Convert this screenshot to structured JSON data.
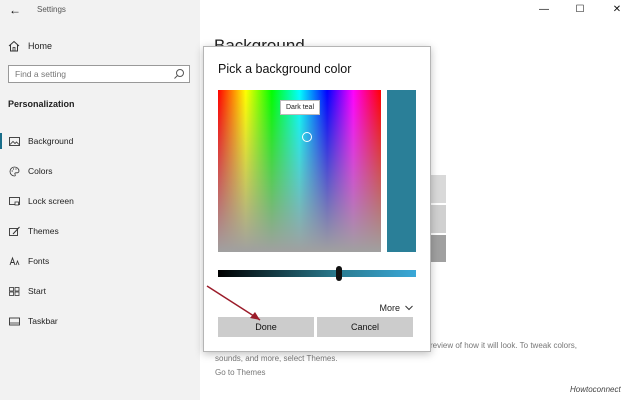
{
  "window": {
    "title": "Settings",
    "back": "←",
    "min": "—",
    "max": "☐",
    "close": "✕"
  },
  "sidebar": {
    "home_label": "Home",
    "search_placeholder": "Find a setting",
    "section_heading": "Personalization",
    "items": [
      {
        "label": "Background",
        "icon": "image-icon"
      },
      {
        "label": "Colors",
        "icon": "palette-icon"
      },
      {
        "label": "Lock screen",
        "icon": "lock-screen-icon"
      },
      {
        "label": "Themes",
        "icon": "brush-icon"
      },
      {
        "label": "Fonts",
        "icon": "font-icon"
      },
      {
        "label": "Start",
        "icon": "start-grid-icon"
      },
      {
        "label": "Taskbar",
        "icon": "taskbar-icon"
      }
    ]
  },
  "page": {
    "title": "Background",
    "desc_line1": "review of how it will look. To tweak colors,",
    "desc_line2": "sounds, and more, select Themes.",
    "go_themes": "Go to Themes"
  },
  "dialog": {
    "title": "Pick a background color",
    "tooltip": "Dark teal",
    "selected_color": "#2a7f98",
    "more_label": "More",
    "done_label": "Done",
    "cancel_label": "Cancel"
  },
  "watermark": "Howtoconnect",
  "colors": {
    "accent": "#1a6e8a",
    "arrow": "#9b1c2a"
  }
}
